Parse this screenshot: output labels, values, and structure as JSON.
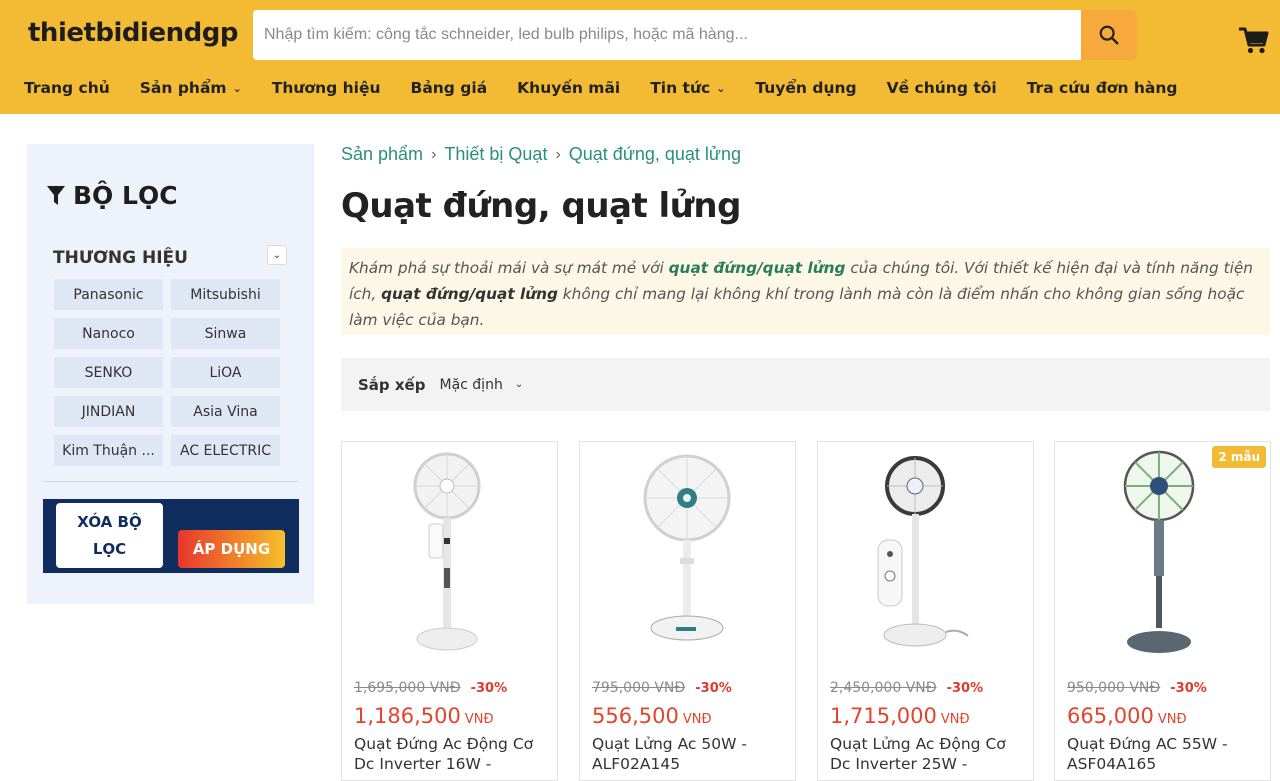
{
  "header": {
    "logo": "thietbidiendgp",
    "search_placeholder": "Nhập tìm kiếm: công tắc schneider, led bulb philips, hoặc mã hàng...",
    "search_icon": "search-icon",
    "cart_icon": "cart-icon"
  },
  "nav": [
    {
      "label": "Trang chủ",
      "dropdown": false
    },
    {
      "label": "Sản phẩm",
      "dropdown": true
    },
    {
      "label": "Thương hiệu",
      "dropdown": false
    },
    {
      "label": "Bảng giá",
      "dropdown": false
    },
    {
      "label": "Khuyến mãi",
      "dropdown": false
    },
    {
      "label": "Tin tức",
      "dropdown": true
    },
    {
      "label": "Tuyển dụng",
      "dropdown": false
    },
    {
      "label": "Về chúng tôi",
      "dropdown": false
    },
    {
      "label": "Tra cứu đơn hàng",
      "dropdown": false
    }
  ],
  "sidebar": {
    "title": "BỘ LỌC",
    "brand_heading": "THƯƠNG HIỆU",
    "brands": [
      "Panasonic",
      "Mitsubishi",
      "Nanoco",
      "Sinwa",
      "SENKO",
      "LiOA",
      "JINDIAN",
      "Asia Vina",
      "Kim Thuận ...",
      "AC ELECTRIC"
    ],
    "clear_label": "XÓA BỘ LỌC",
    "apply_label": "ÁP DỤNG"
  },
  "breadcrumb": [
    "Sản phẩm",
    "Thiết bị Quạt",
    "Quạt đứng, quạt lửng"
  ],
  "page_title": "Quạt đứng, quạt lửng",
  "description": {
    "p1": "Khám phá sự thoải mái và sự mát mẻ với ",
    "b1": "quạt đứng/quạt lửng",
    "p2": " của chúng tôi. Với thiết kế hiện đại và tính năng tiện ích, ",
    "b2": "quạt đứng/quạt lửng",
    "p3": " không chỉ mang lại không khí trong lành mà còn là điểm nhấn cho không gian sống hoặc làm việc của bạn."
  },
  "sort": {
    "label": "Sắp xếp",
    "value": "Mặc định"
  },
  "products": [
    {
      "old_price": "1,695,000 VNĐ",
      "discount": "-30%",
      "price": "1,186,500",
      "unit": "VNĐ",
      "name": "Quạt Đứng Ac Động Cơ Dc Inverter 16W - ",
      "badge": ""
    },
    {
      "old_price": "795,000 VNĐ",
      "discount": "-30%",
      "price": "556,500",
      "unit": "VNĐ",
      "name": "Quạt Lửng Ac 50W - ALF02A145",
      "badge": ""
    },
    {
      "old_price": "2,450,000 VNĐ",
      "discount": "-30%",
      "price": "1,715,000",
      "unit": "VNĐ",
      "name": "Quạt Lửng Ac Động Cơ Dc Inverter 25W - ",
      "badge": ""
    },
    {
      "old_price": "950,000 VNĐ",
      "discount": "-30%",
      "price": "665,000",
      "unit": "VNĐ",
      "name": "Quạt Đứng AC 55W - ASF04A165",
      "badge": "2 mẫu"
    }
  ],
  "colors": {
    "header_bg": "#f3bb34",
    "accent_green": "#2c8e80",
    "price_red": "#e2452c",
    "navy": "#0f2d5e"
  }
}
